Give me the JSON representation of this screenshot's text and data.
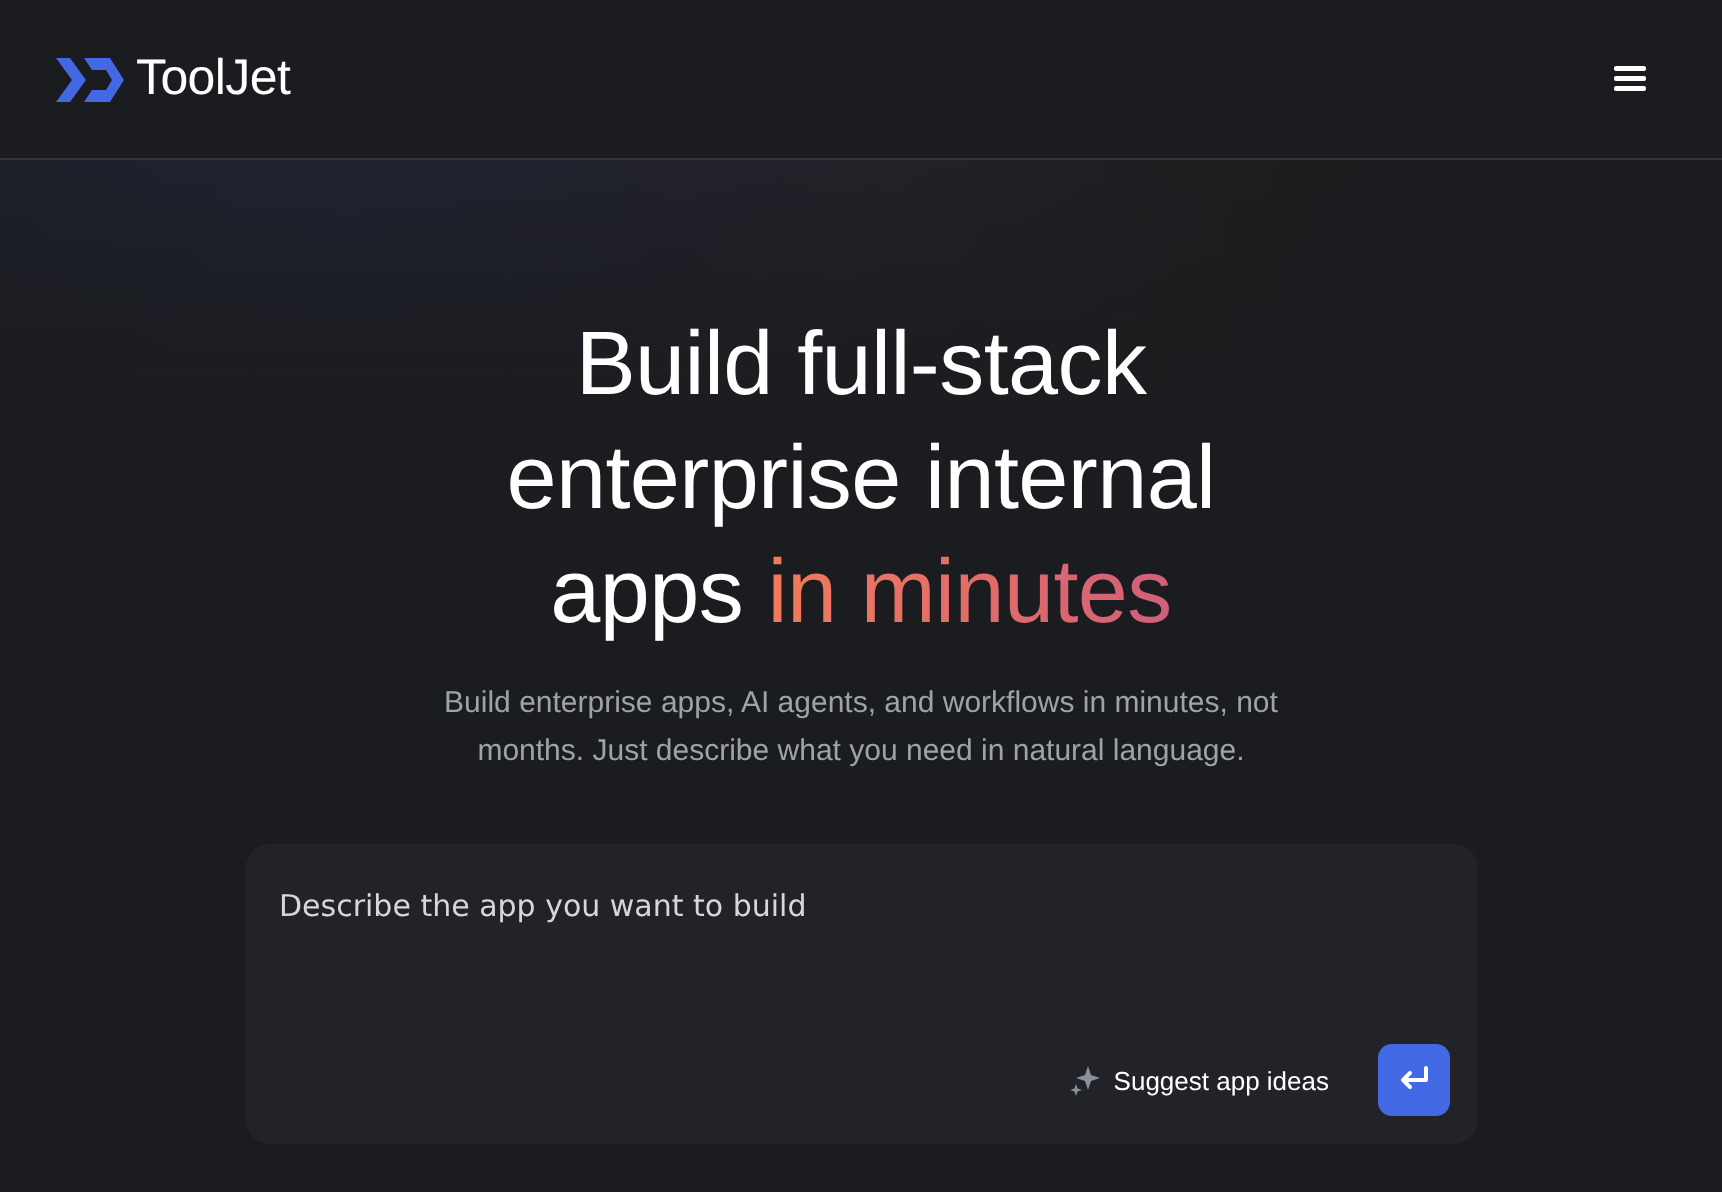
{
  "header": {
    "logo": "ToolJet"
  },
  "hero": {
    "heading": "Build full-stack enterprise internal apps",
    "highlight": "in minutes",
    "subtitle": "Build enterprise apps, AI agents, and workflows in minutes, not months. Just describe what you need in natural language."
  },
  "prompt": {
    "placeholder": "Describe the app you want to build",
    "suggest": "Suggest app ideas"
  }
}
